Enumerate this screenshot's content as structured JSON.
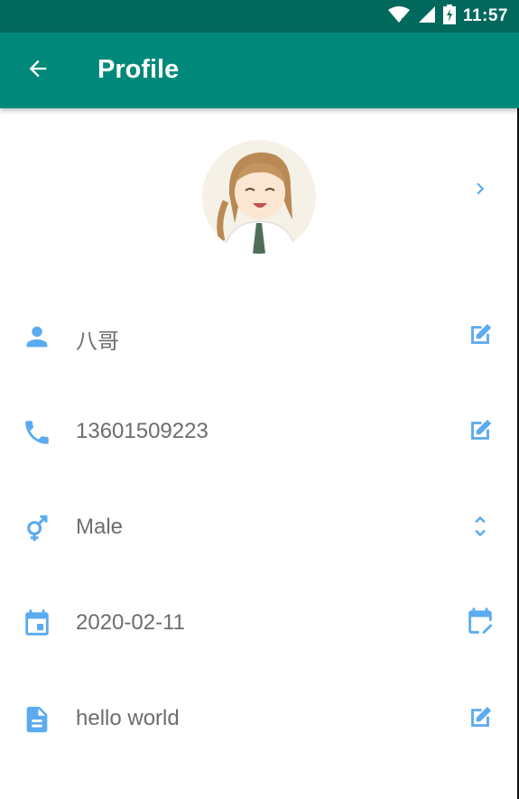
{
  "status_bar": {
    "time": "11:57"
  },
  "app_bar": {
    "title": "Profile"
  },
  "fields": {
    "name": "八哥",
    "phone": "13601509223",
    "gender": "Male",
    "date": "2020-02-11",
    "bio": "hello world"
  },
  "colors": {
    "primary": "#00897b",
    "primary_dark": "#00695c",
    "accent_icon": "#5aabef"
  },
  "icons": {
    "back": "arrow-back-icon",
    "avatar_detail": "chevron-right-icon",
    "name": "person-icon",
    "phone": "phone-icon",
    "gender": "gender-icon",
    "date": "calendar-icon",
    "bio": "document-icon",
    "edit": "edit-icon",
    "select": "unfold-more-icon",
    "date_edit": "calendar-edit-icon"
  }
}
